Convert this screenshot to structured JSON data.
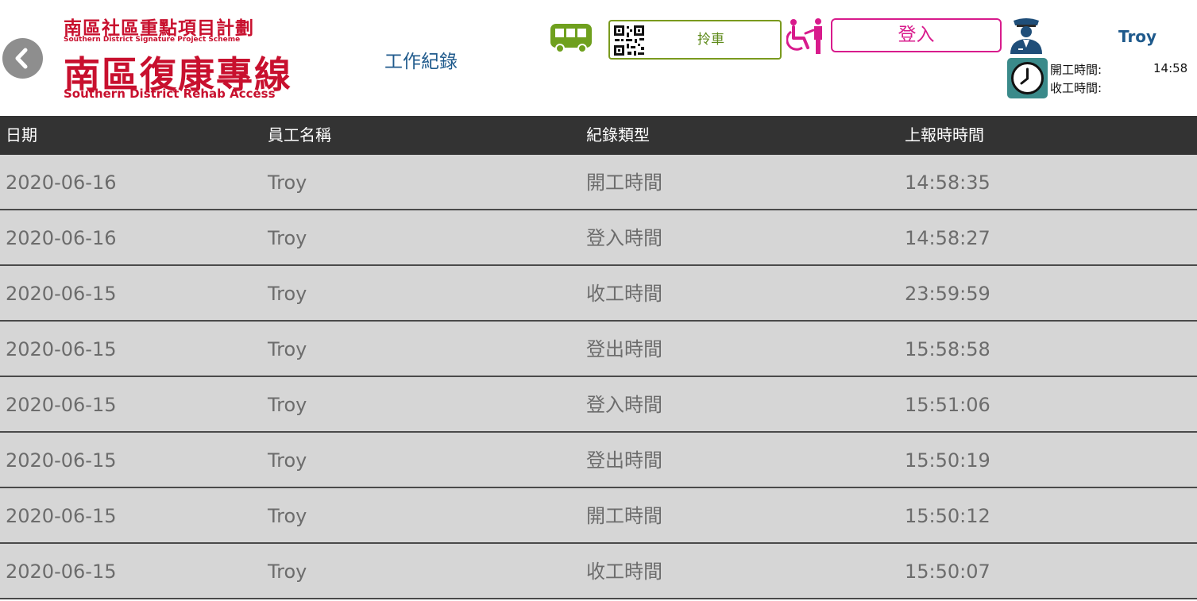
{
  "header": {
    "logo": {
      "line1": "南區社區重點項目計劃",
      "line2": "Southern District Signature Project Scheme",
      "line3": "南區復康專線",
      "line4": "Southern District Rehab Access"
    },
    "page_title": "工作紀錄",
    "pickup_label": "拎車",
    "login_label": "登入",
    "username": "Troy",
    "clock": {
      "start_label": "開工時間:",
      "start_value": "14:58",
      "end_label": "收工時間:",
      "end_value": ""
    },
    "icons": {
      "back": "chevron-left-icon",
      "bus": "bus-icon",
      "qr": "qr-code-icon",
      "wheelchair": "wheelchair-assist-icon",
      "driver": "driver-icon",
      "clock": "clock-icon"
    },
    "colors": {
      "brand_red": "#c8102e",
      "title_blue": "#1f5a8c",
      "green": "#7a9a1e",
      "magenta": "#d81b8c",
      "header_bar": "#333333",
      "row_bg": "#d6d6d6"
    }
  },
  "table": {
    "headers": [
      "日期",
      "員工名稱",
      "紀錄類型",
      "上報時時間"
    ],
    "rows": [
      [
        "2020-06-16",
        "Troy",
        "開工時間",
        "14:58:35"
      ],
      [
        "2020-06-16",
        "Troy",
        "登入時間",
        "14:58:27"
      ],
      [
        "2020-06-15",
        "Troy",
        "收工時間",
        "23:59:59"
      ],
      [
        "2020-06-15",
        "Troy",
        "登出時間",
        "15:58:58"
      ],
      [
        "2020-06-15",
        "Troy",
        "登入時間",
        "15:51:06"
      ],
      [
        "2020-06-15",
        "Troy",
        "登出時間",
        "15:50:19"
      ],
      [
        "2020-06-15",
        "Troy",
        "開工時間",
        "15:50:12"
      ],
      [
        "2020-06-15",
        "Troy",
        "收工時間",
        "15:50:07"
      ]
    ]
  }
}
